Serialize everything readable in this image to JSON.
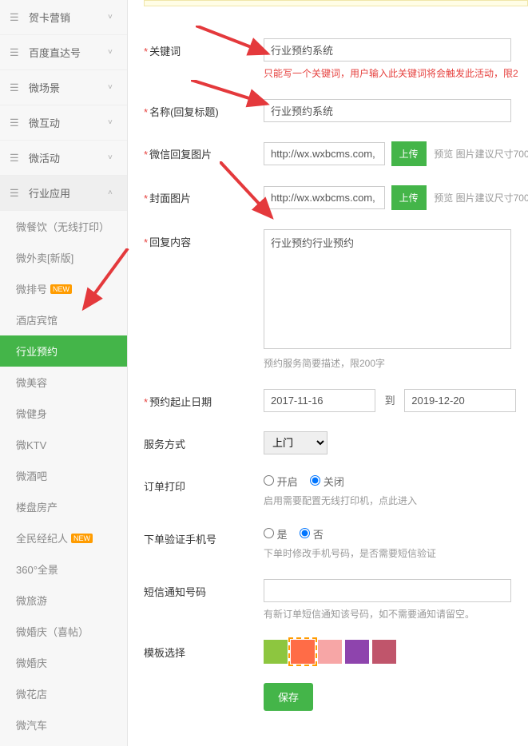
{
  "sidebar": {
    "nav": [
      {
        "icon": "card",
        "label": "贺卡营销",
        "chev": "down"
      },
      {
        "icon": "baidu",
        "label": "百度直达号",
        "chev": "down"
      },
      {
        "icon": "scene",
        "label": "微场景",
        "chev": "down"
      },
      {
        "icon": "interact",
        "label": "微互动",
        "chev": "down"
      },
      {
        "icon": "activity",
        "label": "微活动",
        "chev": "down"
      },
      {
        "icon": "industry",
        "label": "行业应用",
        "chev": "up"
      }
    ],
    "sub": [
      {
        "label": "微餐饮（无线打印）"
      },
      {
        "label": "微外卖[新版]"
      },
      {
        "label": "微排号",
        "new": true
      },
      {
        "label": "酒店宾馆"
      },
      {
        "label": "行业预约",
        "active": true
      },
      {
        "label": "微美容"
      },
      {
        "label": "微健身"
      },
      {
        "label": "微KTV"
      },
      {
        "label": "微酒吧"
      },
      {
        "label": "楼盘房产"
      },
      {
        "label": "全民经纪人",
        "new": true
      },
      {
        "label": "360°全景"
      },
      {
        "label": "微旅游"
      },
      {
        "label": "微婚庆（喜帖）"
      },
      {
        "label": "微婚庆"
      },
      {
        "label": "微花店"
      },
      {
        "label": "微汽车"
      }
    ],
    "new_badge": "NEW"
  },
  "form": {
    "keyword": {
      "label": "关键词",
      "value": "行业预约系统",
      "hint": "只能写一个关键词，用户输入此关键词将会触发此活动，限2"
    },
    "name": {
      "label": "名称(回复标题)",
      "value": "行业预约系统"
    },
    "wechatimg": {
      "label": "微信回复图片",
      "value": "http://wx.wxbcms.com,",
      "upload": "上传",
      "hint": "预览 图片建议尺寸700"
    },
    "coverimg": {
      "label": "封面图片",
      "value": "http://wx.wxbcms.com,",
      "upload": "上传",
      "hint": "预览 图片建议尺寸700"
    },
    "content": {
      "label": "回复内容",
      "value": "行业预约行业预约",
      "hint": "预约服务简要描述，限200字"
    },
    "daterange": {
      "label": "预约起止日期",
      "start": "2017-11-16",
      "sep": "到",
      "end": "2019-12-20"
    },
    "service": {
      "label": "服务方式",
      "value": "上门"
    },
    "print": {
      "label": "订单打印",
      "opt_on": "开启",
      "opt_off": "关闭",
      "hint": "启用需要配置无线打印机，点此进入"
    },
    "verify": {
      "label": "下单验证手机号",
      "opt_yes": "是",
      "opt_no": "否",
      "hint": "下单时修改手机号码，是否需要短信验证"
    },
    "sms": {
      "label": "短信通知号码",
      "value": "",
      "hint": "有新订单短信通知该号码，如不需要通知请留空。"
    },
    "template": {
      "label": "模板选择"
    },
    "save": "保存"
  },
  "colors": [
    "#8dc63f",
    "#ff6c47",
    "#f7a6a6",
    "#8e44ad",
    "#c0556b"
  ]
}
